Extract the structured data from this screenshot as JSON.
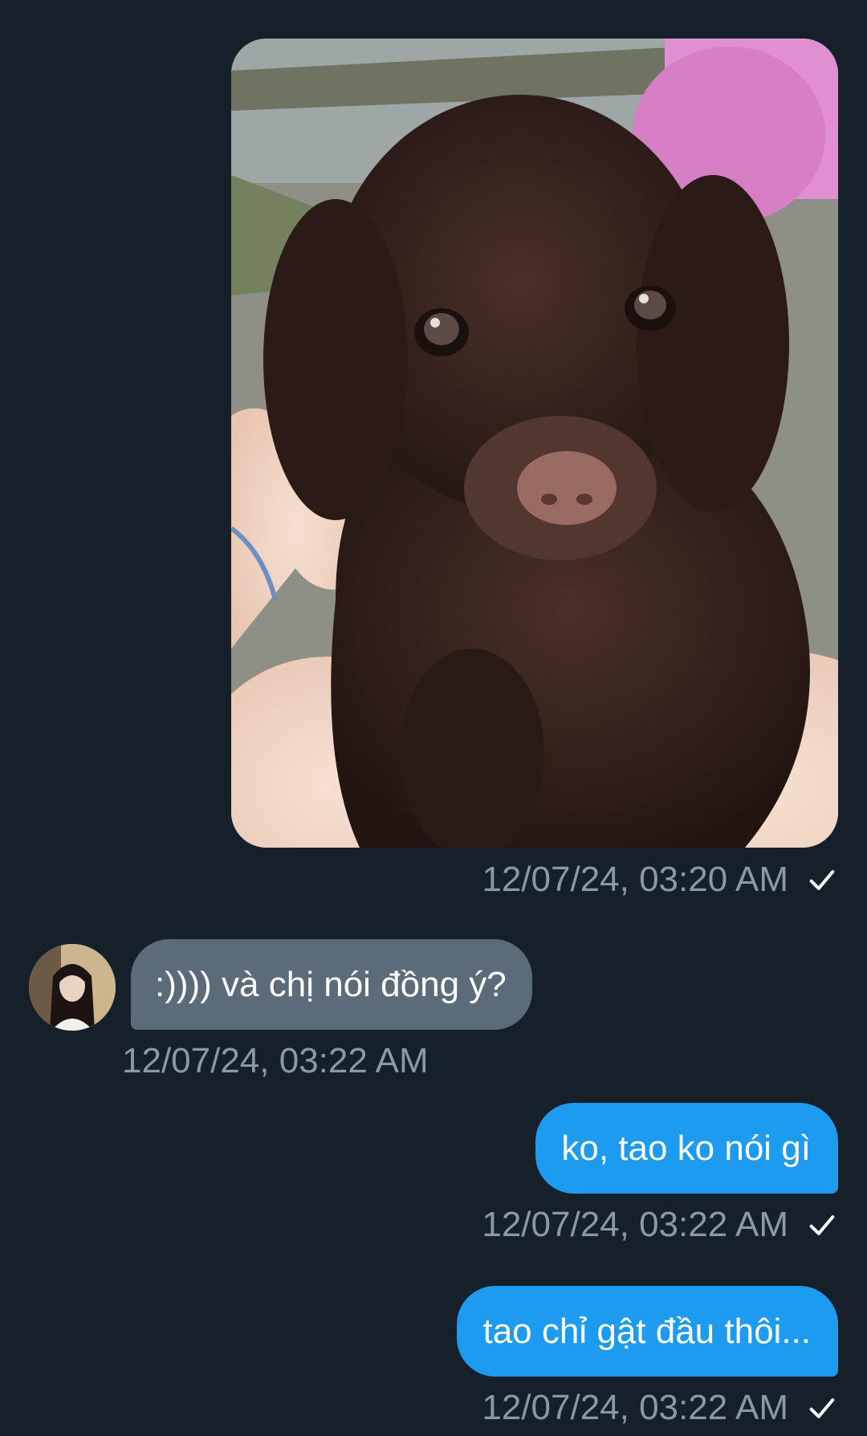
{
  "conversation": {
    "messages": [
      {
        "direction": "outgoing",
        "type": "image",
        "image_subject": "puppy-photo",
        "timestamp": "12/07/24, 03:20 AM",
        "status_icon": "check-icon"
      },
      {
        "direction": "incoming",
        "type": "text",
        "avatar_icon": "avatar",
        "text": ":)))) và chị nói đồng ý?",
        "timestamp": "12/07/24, 03:22 AM"
      },
      {
        "direction": "outgoing",
        "type": "text",
        "text": "ko, tao ko nói gì",
        "timestamp": "12/07/24, 03:22 AM",
        "status_icon": "check-icon"
      },
      {
        "direction": "outgoing",
        "type": "text",
        "text": "tao chỉ gật đầu thôi...",
        "timestamp": "12/07/24, 03:22 AM",
        "status_icon": "check-icon"
      }
    ]
  },
  "colors": {
    "background": "#15202b",
    "outgoing_bubble": "#1d9bf0",
    "incoming_bubble": "#5b6b79",
    "timestamp": "#8b98a5",
    "message_text": "#ffffff"
  }
}
